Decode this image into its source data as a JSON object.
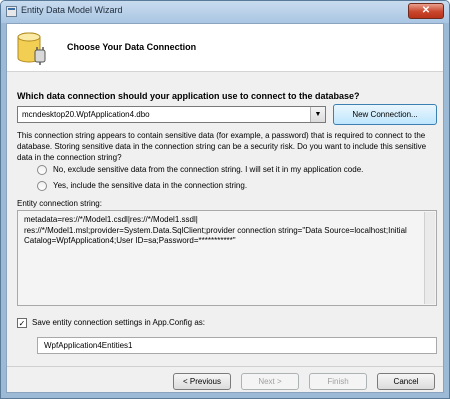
{
  "window": {
    "title": "Entity Data Model Wizard",
    "close_glyph": "✕"
  },
  "header": {
    "title": "Choose Your Data Connection",
    "icon": "database-icon"
  },
  "connection": {
    "question": "Which data connection should your application use to connect to the database?",
    "selected": "mcndesktop20.WpfApplication4.dbo",
    "dropdown_glyph": "▼",
    "new_connection_label": "New Connection..."
  },
  "sensitive": {
    "description": "This connection string appears to contain sensitive data (for example, a password) that is required to connect to the database. Storing sensitive data in the connection string can be a security risk. Do you want to include this sensitive data in the connection string?",
    "option_no": "No, exclude sensitive data from the connection string. I will set it in my application code.",
    "option_yes": "Yes, include the sensitive data in the connection string."
  },
  "entity": {
    "label": "Entity connection string:",
    "value": "metadata=res://*/Model1.csdl|res://*/Model1.ssdl|\nres://*/Model1.msl;provider=System.Data.SqlClient;provider connection string=\"Data Source=localhost;Initial Catalog=WpfApplication4;User ID=sa;Password=***********\""
  },
  "save": {
    "checked": true,
    "check_glyph": "✓",
    "label": "Save entity connection settings in App.Config as:",
    "name_value": "WpfApplication4Entities1"
  },
  "footer": {
    "previous": "< Previous",
    "next": "Next >",
    "finish": "Finish",
    "cancel": "Cancel"
  }
}
